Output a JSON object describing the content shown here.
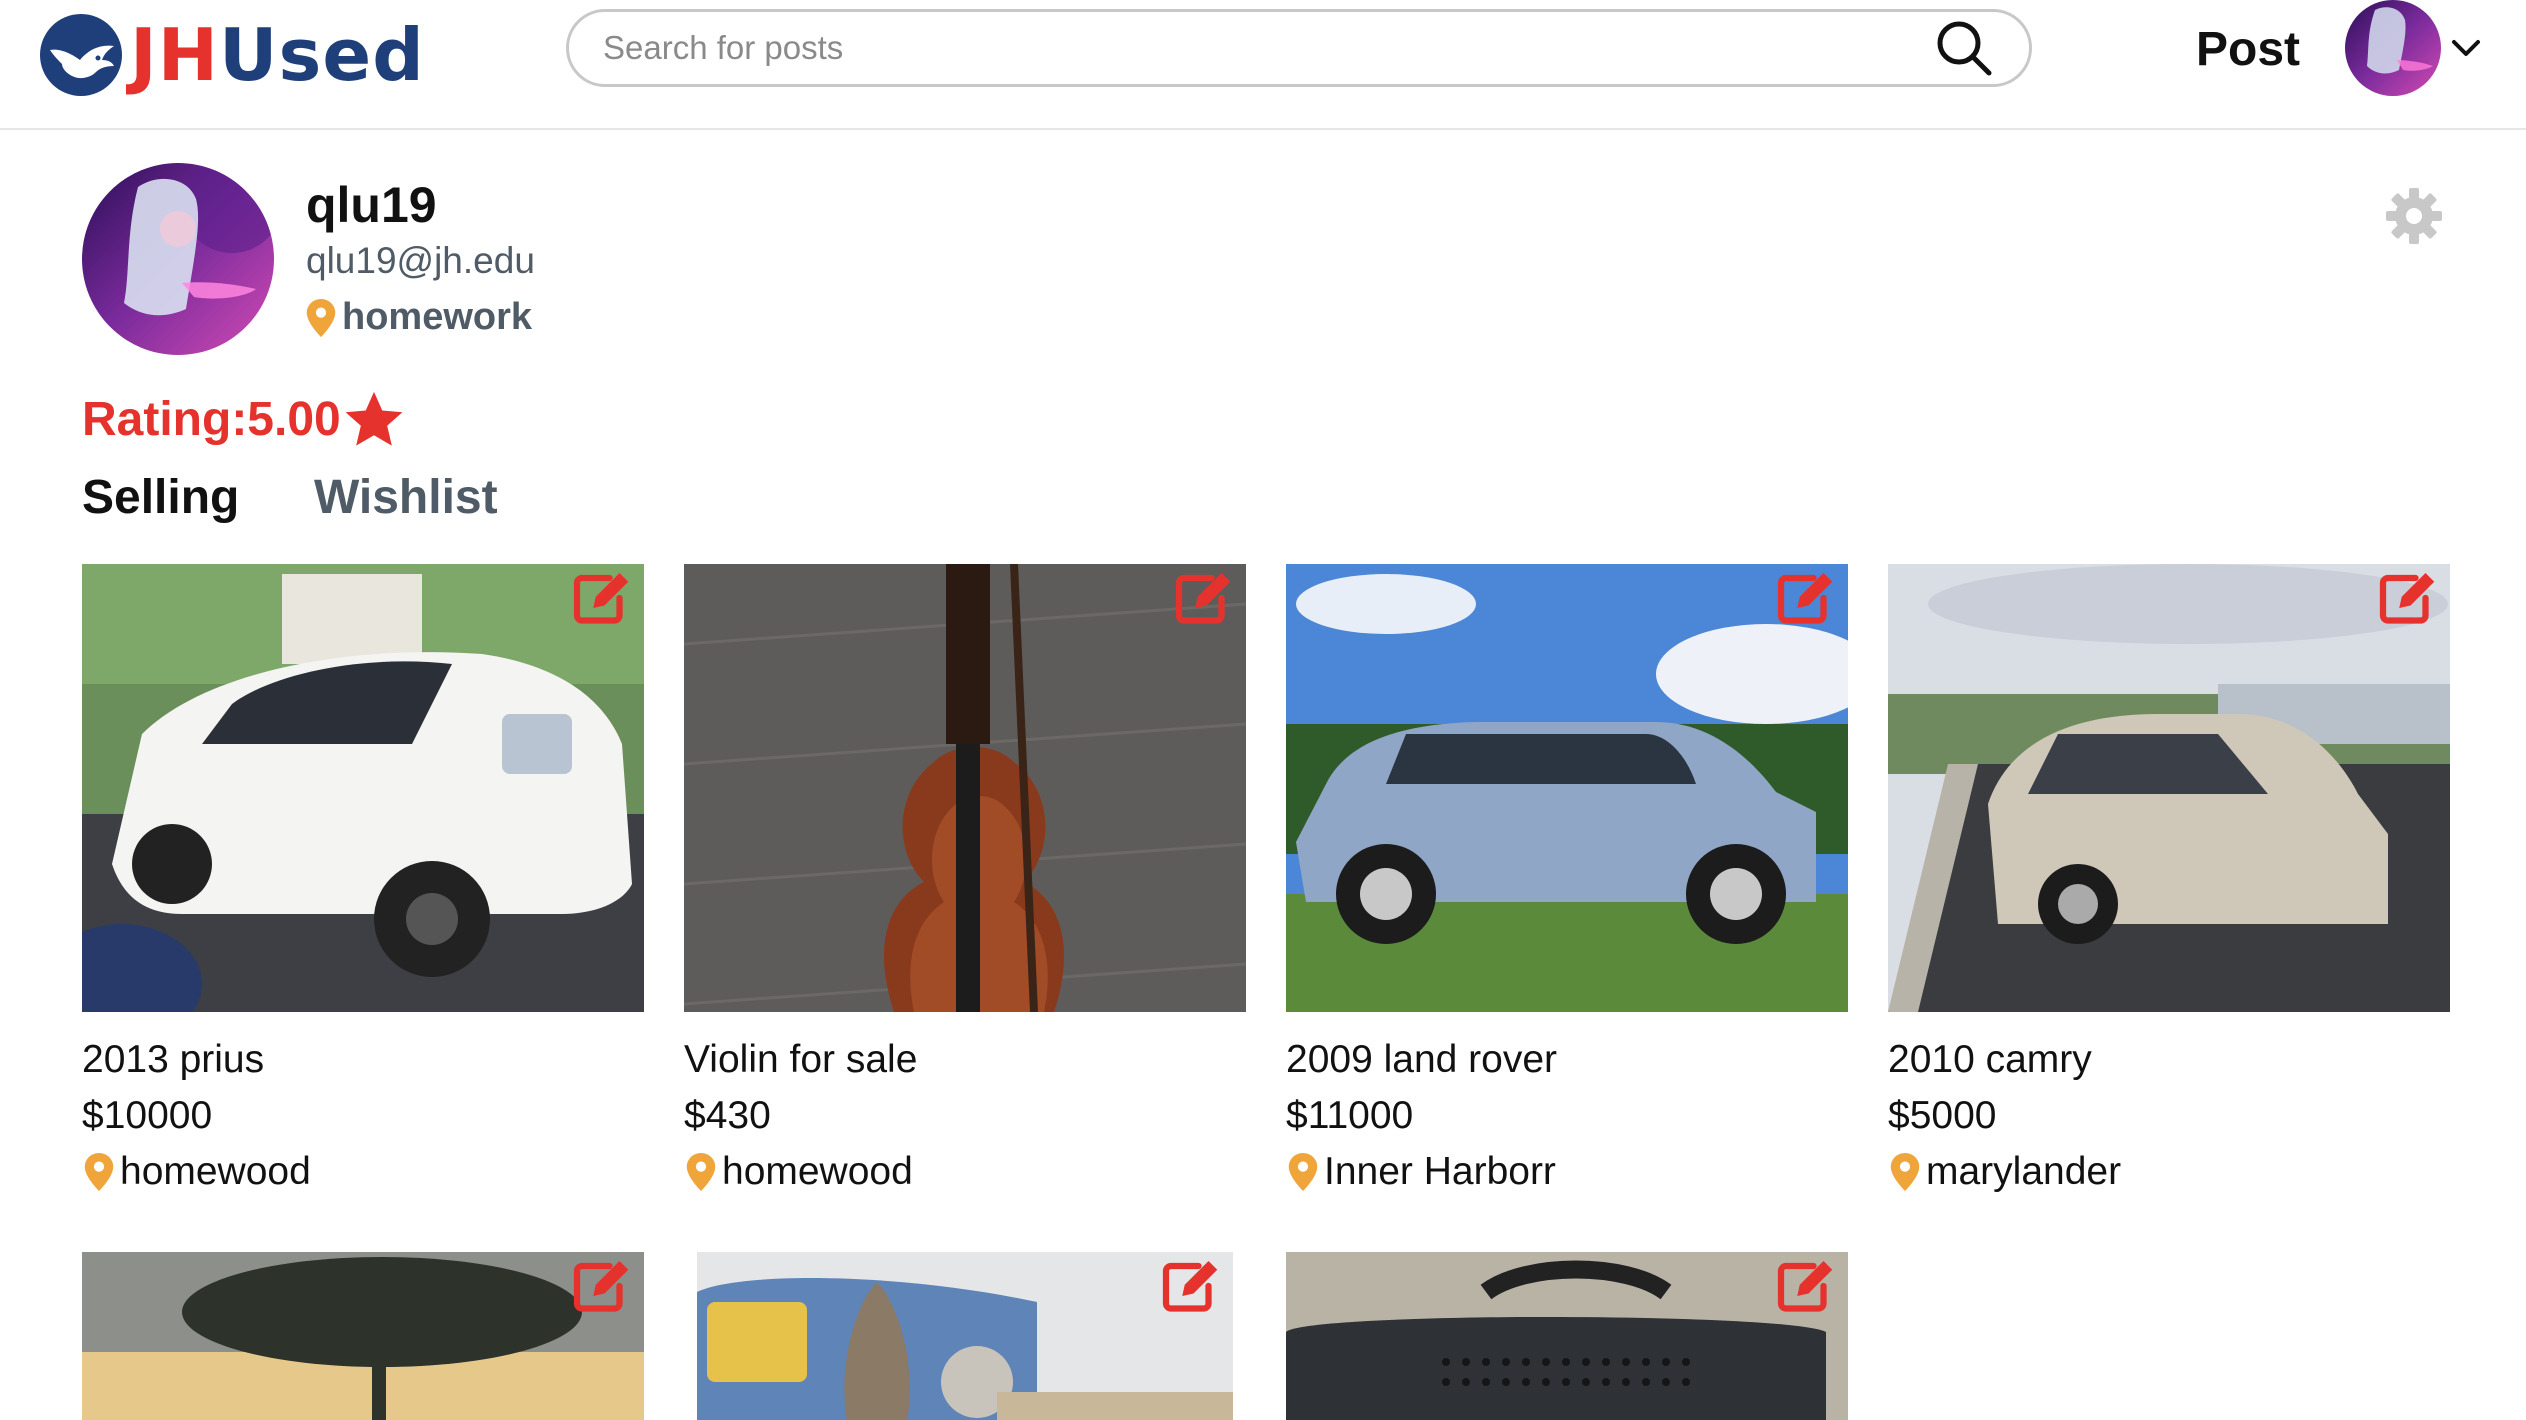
{
  "header": {
    "logo_jh": "JH",
    "logo_used": "Used",
    "search_placeholder": "Search for posts",
    "post_label": "Post"
  },
  "profile": {
    "username": "qlu19",
    "email": "qlu19@jh.edu",
    "location": "homework",
    "rating_label": "Rating:5.00"
  },
  "tabs": {
    "selling": "Selling",
    "wishlist": "Wishlist"
  },
  "listings": [
    {
      "title": "2013 prius",
      "price": "$10000",
      "location": "homewood"
    },
    {
      "title": "Violin for sale",
      "price": "$430",
      "location": "homewood"
    },
    {
      "title": "2009 land rover",
      "price": "$11000",
      "location": "Inner Harborr"
    },
    {
      "title": "2010 camry",
      "price": "$5000",
      "location": "marylander"
    }
  ],
  "colors": {
    "brand_red": "#e5322d",
    "brand_navy": "#1f3f7a",
    "pin_orange": "#f0a53a",
    "muted_text": "#4f5b66"
  },
  "icons": {
    "search": "search-icon",
    "caret": "chevron-down-icon",
    "gear": "gear-icon",
    "star": "star-icon",
    "pin": "location-pin-icon",
    "edit": "edit-icon"
  }
}
